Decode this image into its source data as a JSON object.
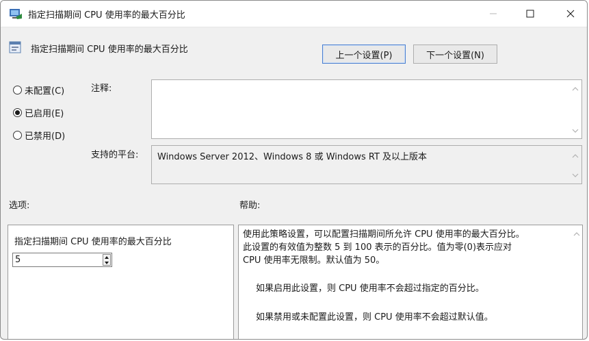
{
  "window": {
    "title": "指定扫描期间 CPU 使用率的最大百分比",
    "minimize_glyph": "—",
    "maximize_glyph": "☐",
    "close_glyph": "✕"
  },
  "header": {
    "policy_title": "指定扫描期间 CPU 使用率的最大百分比",
    "prev_button": "上一个设置(P)",
    "next_button": "下一个设置(N)"
  },
  "state": {
    "options": [
      {
        "label": "未配置(C)",
        "checked": false
      },
      {
        "label": "已启用(E)",
        "checked": true
      },
      {
        "label": "已禁用(D)",
        "checked": false
      }
    ]
  },
  "comment": {
    "label": "注释:",
    "value": ""
  },
  "platform": {
    "label": "支持的平台:",
    "value": "Windows Server 2012、Windows 8 或 Windows RT 及以上版本"
  },
  "options_section": {
    "label": "选项:",
    "setting_label": "指定扫描期间 CPU 使用率的最大百分比",
    "setting_value": "5"
  },
  "help_section": {
    "label": "帮助:",
    "lines": [
      "使用此策略设置，可以配置扫描期间所允许 CPU 使用率的最大百分比。",
      "此设置的有效值为整数 5 到 100 表示的百分比。值为零(0)表示应对",
      "CPU 使用率无限制。默认值为 50。",
      "如果启用此设置，则 CPU 使用率不会超过指定的百分比。",
      "如果禁用或未配置此设置，则 CPU 使用率不会超过默认值。"
    ]
  },
  "icons": {
    "app": "policy-app-icon",
    "policy": "policy-setting-icon",
    "scroll_up": "chevron-up-icon",
    "scroll_down": "chevron-down-icon",
    "spin_up": "triangle-up-icon",
    "spin_down": "triangle-down-icon"
  },
  "colors": {
    "accent_border": "#4a7fd0",
    "window_bg": "#f0f0f0"
  }
}
